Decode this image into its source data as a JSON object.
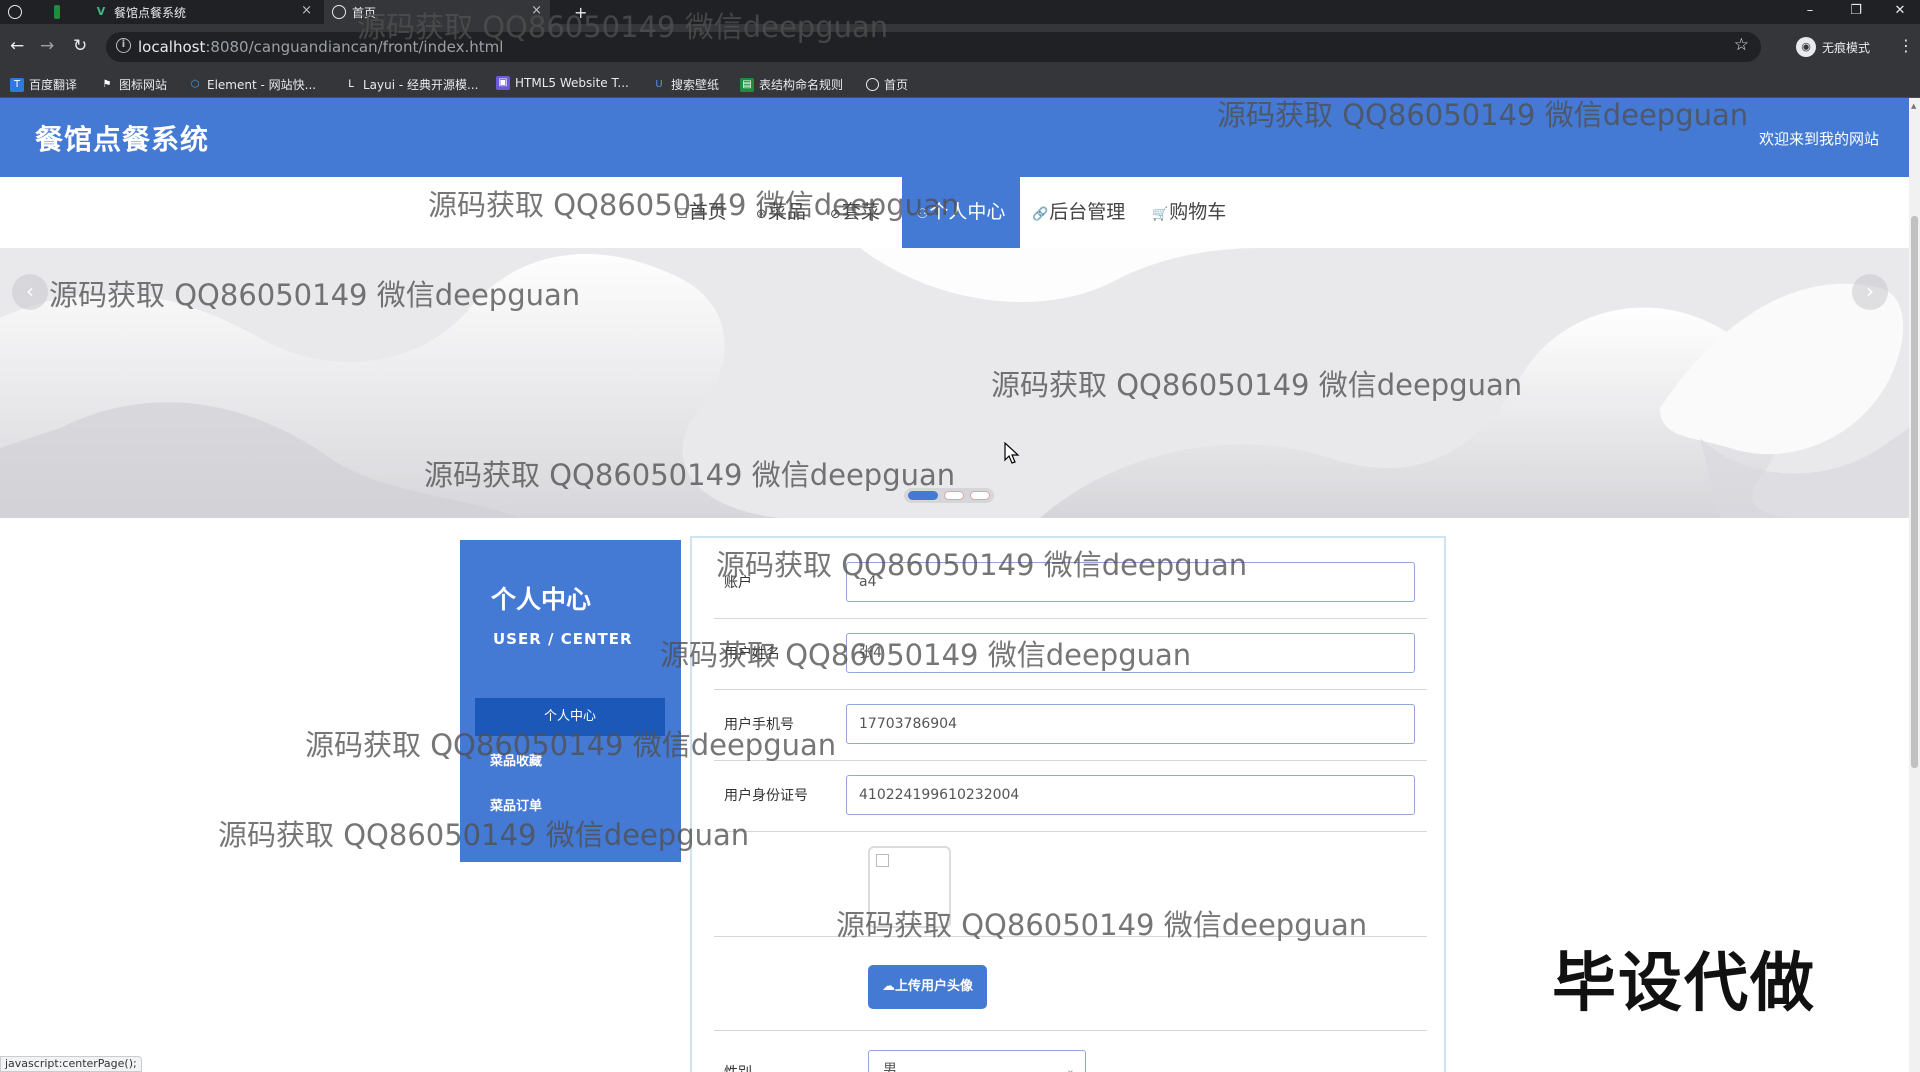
{
  "browser": {
    "tabs": [
      {
        "title": "餐馆点餐系统",
        "close": "×"
      },
      {
        "title": "首页",
        "close": "×"
      }
    ],
    "new_tab": "+",
    "window_controls": {
      "minimize": "–",
      "restore": "❐",
      "close": "✕"
    },
    "url_host": "localhost",
    "url_path": ":8080/canguandiancan/front/index.html",
    "profile_label": "无痕模式",
    "bookmarks": [
      "百度翻译",
      "图标网站",
      "Element - 网站快...",
      "Layui - 经典开源模...",
      "HTML5 Website T...",
      "搜索壁纸",
      "表结构命名规则",
      "首页"
    ],
    "status_text": "javascript:centerPage();"
  },
  "site": {
    "title": "餐馆点餐系统",
    "welcome": "欢迎来到我的网站"
  },
  "nav": [
    {
      "icon": "☐",
      "label": "首页"
    },
    {
      "icon": "⊛",
      "label": "菜品"
    },
    {
      "icon": "⊘",
      "label": "套菜"
    },
    {
      "icon": "⚇",
      "label": "个人中心"
    },
    {
      "icon": "🔗",
      "label": "后台管理"
    },
    {
      "icon": "🛒",
      "label": "购物车"
    }
  ],
  "carousel": {
    "prev": "‹",
    "next": "›",
    "active_index": 0,
    "count": 3
  },
  "user_center": {
    "title": "个人中心",
    "subtitle": "USER / CENTER",
    "items": [
      "个人中心",
      "菜品收藏",
      "菜品订单"
    ]
  },
  "form": {
    "account_label": "账户",
    "account_value": "a4",
    "name_label": "用户姓名",
    "name_value": "张4",
    "phone_label": "用户手机号",
    "phone_value": "17703786904",
    "idcard_label": "用户身份证号",
    "idcard_value": "410224199610232004",
    "upload_button": "上传用户头像",
    "gender_label": "性别",
    "gender_value": "男"
  },
  "watermark": "源码获取 QQ86050149 微信deepguan",
  "overlay_text": "毕设代做"
}
